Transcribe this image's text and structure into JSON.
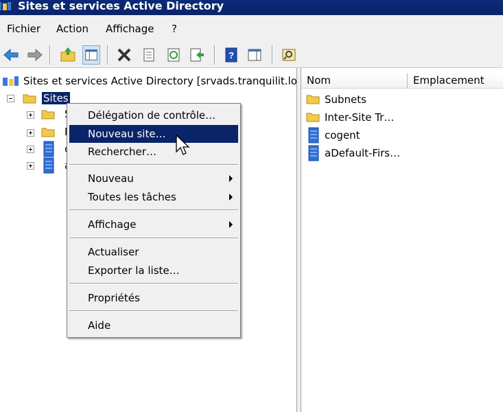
{
  "window": {
    "title": "Sites et services Active Directory"
  },
  "menubar": {
    "items": [
      "Fichier",
      "Action",
      "Affichage",
      "?"
    ]
  },
  "toolbar": {
    "icons": [
      "back-icon",
      "forward-icon",
      "up-folder-icon",
      "show-hide-tree-icon",
      "delete-icon",
      "properties-icon",
      "refresh-icon",
      "export-list-icon",
      "help-icon",
      "show-action-pane-icon",
      "find-icon"
    ]
  },
  "tree": {
    "root_label": "Sites et services Active Directory [srvads.tranquilit.lo",
    "sites_label": "Sites",
    "child_hint_1": "S",
    "child_hint_2": "I",
    "child_hint_3": "c",
    "child_hint_4": "a"
  },
  "list": {
    "columns": [
      "Nom",
      "Emplacement"
    ],
    "items": [
      {
        "name": "Subnets",
        "type": "folder"
      },
      {
        "name": "Inter-Site Tr…",
        "type": "folder"
      },
      {
        "name": "cogent",
        "type": "site"
      },
      {
        "name": "aDefault-Firs…",
        "type": "site"
      }
    ]
  },
  "context_menu": {
    "items": [
      {
        "label": "Délégation de contrôle…"
      },
      {
        "label": "Nouveau site…",
        "highlighted": true
      },
      {
        "label": "Rechercher…"
      },
      {
        "label": "Nouveau",
        "submenu": true
      },
      {
        "label": "Toutes les tâches",
        "submenu": true
      },
      {
        "label": "Affichage",
        "submenu": true
      },
      {
        "label": "Actualiser"
      },
      {
        "label": "Exporter la liste…"
      },
      {
        "label": "Propriétés"
      },
      {
        "label": "Aide"
      }
    ]
  },
  "colors": {
    "selection": "#0a246a",
    "folder": "#f2c94c",
    "server": "#2f6fd6"
  }
}
